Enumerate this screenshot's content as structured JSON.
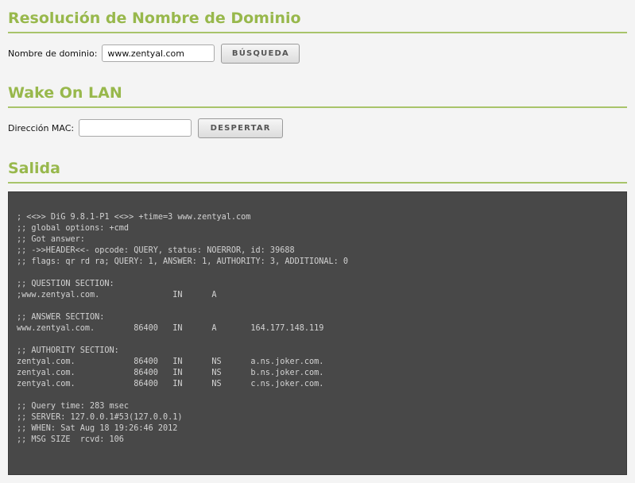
{
  "dns": {
    "title": "Resolución de Nombre de Dominio",
    "label": "Nombre de dominio:",
    "value": "www.zentyal.com",
    "button_label": "BÚSQUEDA"
  },
  "wol": {
    "title": "Wake On LAN",
    "label": "Dirección MAC:",
    "value": "",
    "button_label": "DESPERTAR"
  },
  "output": {
    "title": "Salida",
    "text": "; <<>> DiG 9.8.1-P1 <<>> +time=3 www.zentyal.com\n;; global options: +cmd\n;; Got answer:\n;; ->>HEADER<<- opcode: QUERY, status: NOERROR, id: 39688\n;; flags: qr rd ra; QUERY: 1, ANSWER: 1, AUTHORITY: 3, ADDITIONAL: 0\n\n;; QUESTION SECTION:\n;www.zentyal.com.               IN      A\n\n;; ANSWER SECTION:\nwww.zentyal.com.        86400   IN      A       164.177.148.119\n\n;; AUTHORITY SECTION:\nzentyal.com.            86400   IN      NS      a.ns.joker.com.\nzentyal.com.            86400   IN      NS      b.ns.joker.com.\nzentyal.com.            86400   IN      NS      c.ns.joker.com.\n\n;; Query time: 283 msec\n;; SERVER: 127.0.0.1#53(127.0.0.1)\n;; WHEN: Sat Aug 18 19:26:46 2012\n;; MSG SIZE  rcvd: 106"
  },
  "colors": {
    "accent": "#98b84c",
    "output_background": "#484848",
    "output_text": "#d2d2d2"
  }
}
